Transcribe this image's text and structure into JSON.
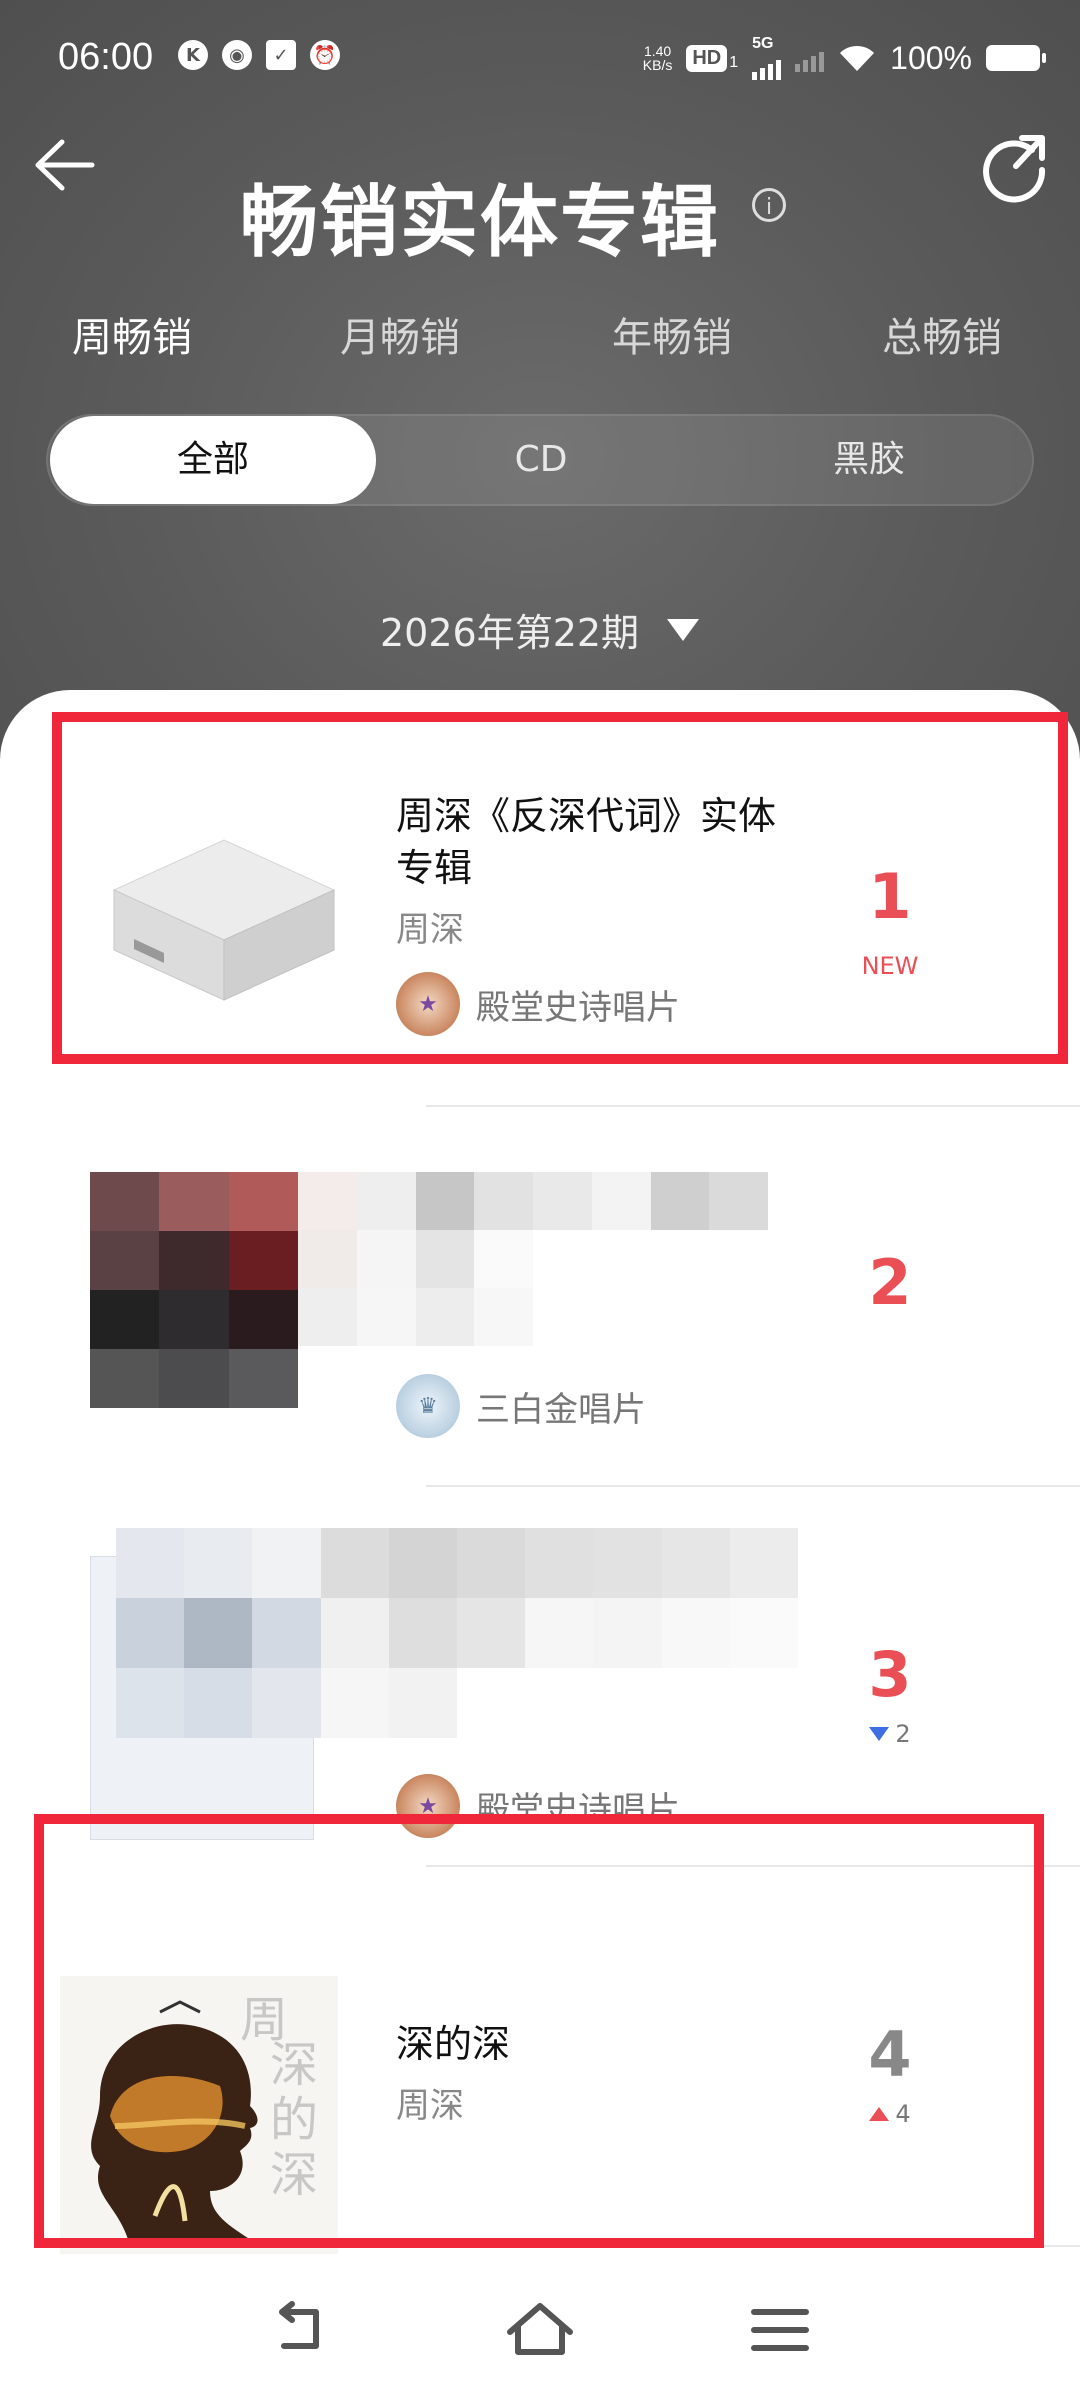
{
  "status_bar": {
    "time": "06:00",
    "net_speed_value": "1.40",
    "net_speed_unit": "KB/s",
    "hd": "HD",
    "hd_sub": "1",
    "network": "5G",
    "battery": "100%"
  },
  "header": {
    "title": "畅销实体专辑",
    "info_symbol": "i"
  },
  "period_tabs": [
    {
      "label": "周畅销",
      "active": true
    },
    {
      "label": "月畅销",
      "active": false
    },
    {
      "label": "年畅销",
      "active": false
    },
    {
      "label": "总畅销",
      "active": false
    }
  ],
  "format_tabs": [
    {
      "label": "全部",
      "active": true
    },
    {
      "label": "CD",
      "active": false
    },
    {
      "label": "黑胶",
      "active": false
    }
  ],
  "period_selector": {
    "label": "2026年第22期"
  },
  "items": [
    {
      "rank": "1",
      "name_line1": "周深《反深代词》实体",
      "name_line2": "专辑",
      "artist": "周深",
      "badge": "殿堂史诗唱片",
      "status": "NEW"
    },
    {
      "rank": "2",
      "badge": "三白金唱片"
    },
    {
      "rank": "3",
      "badge": "殿堂史诗唱片",
      "change": "2",
      "direction": "down"
    },
    {
      "rank": "4",
      "name_line1": "深的深",
      "artist": "周深",
      "change": "4",
      "direction": "up"
    }
  ],
  "colors": {
    "accent_red": "#ea4f55",
    "highlight_red": "#f0263a",
    "down_blue": "#3d6fe3"
  }
}
